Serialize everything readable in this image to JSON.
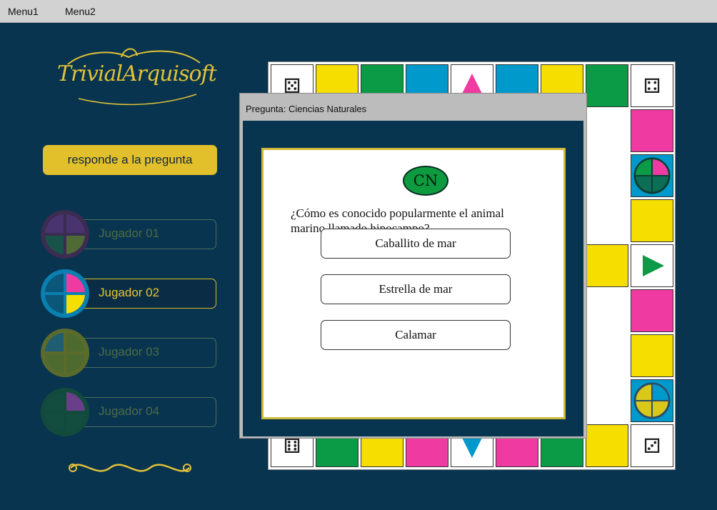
{
  "menubar": {
    "items": [
      "Menu1",
      "Menu2"
    ]
  },
  "logo": {
    "text": "TrivialArquisoft"
  },
  "respond_button": {
    "label": "responde a la pregunta"
  },
  "players": [
    {
      "name": "Jugador 01",
      "active": false
    },
    {
      "name": "Jugador 02",
      "active": true
    },
    {
      "name": "Jugador 03",
      "active": false
    },
    {
      "name": "Jugador 04",
      "active": false
    }
  ],
  "dialog": {
    "title": "Pregunta: Ciencias Naturales",
    "category_badge": "CN",
    "question": "¿Cómo es conocido popularmente el animal marino llamado hipocampo?",
    "answers": [
      "Caballito de mar",
      "Estrella de mar",
      "Calamar"
    ]
  },
  "colors": {
    "background": "#08344f",
    "gold": "#e2c02b",
    "yellow": "#f6df00",
    "green": "#0b9a45",
    "blue": "#0099cc",
    "pink": "#ef3ba1",
    "purple": "#6d3f8f"
  },
  "board_icons": [
    "dice-icon",
    "wedge-triangle-icon",
    "roll-again-icon"
  ]
}
